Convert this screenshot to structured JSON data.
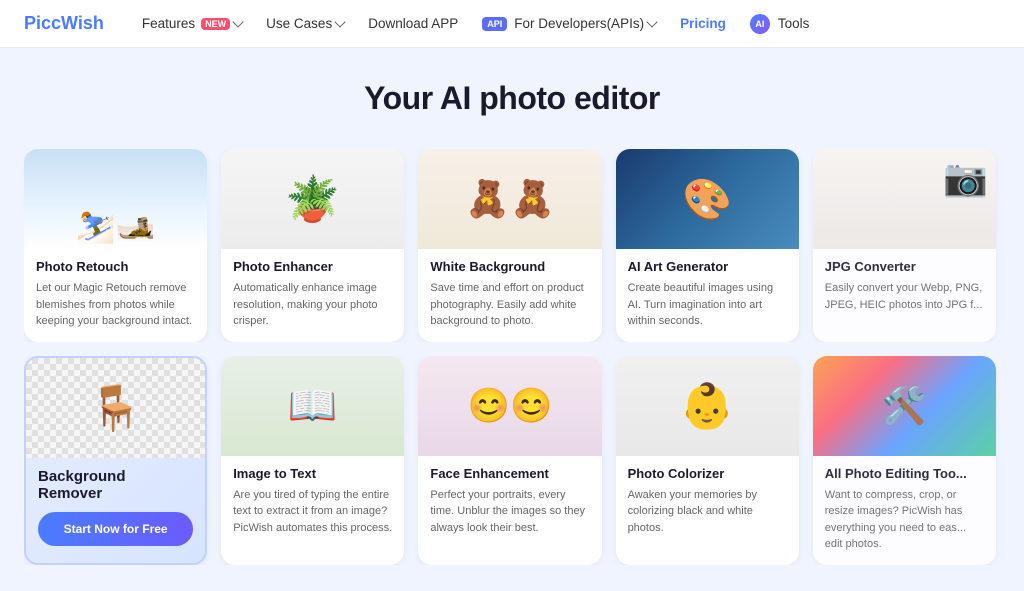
{
  "nav": {
    "logo": "cWish",
    "items": [
      {
        "label": "Features",
        "hasDropdown": true,
        "badge": "new"
      },
      {
        "label": "Use Cases",
        "hasDropdown": true
      },
      {
        "label": "Download APP",
        "hasDropdown": false
      },
      {
        "label": "For Developers(APIs)",
        "hasDropdown": true,
        "apiBadge": true
      },
      {
        "label": "Pricing",
        "isHighlighted": true
      },
      {
        "label": "Tools",
        "aiIcon": true
      }
    ]
  },
  "hero": {
    "title": "Your AI photo editor"
  },
  "row1": [
    {
      "id": "photo-retouch",
      "title": "Photo Retouch",
      "desc": "Let our Magic Retouch remove blemishes from photos while keeping your background intact.",
      "imgClass": "img-skiers"
    },
    {
      "id": "photo-enhancer",
      "title": "Photo Enhancer",
      "desc": "Automatically enhance image resolution, making your photo crisper.",
      "imgClass": "img-plant"
    },
    {
      "id": "white-background",
      "title": "White Background",
      "desc": "Save time and effort on product photography. Easily add white background to photo.",
      "imgClass": "img-bears"
    },
    {
      "id": "ai-art-generator",
      "title": "AI Art Generator",
      "desc": "Create beautiful images using AI. Turn imagination into art within seconds.",
      "imgClass": "img-anime"
    },
    {
      "id": "jpg-converter",
      "title": "JPG Converter",
      "desc": "Easily convert your Webp, PNG, JPEG, HEIC photos into JPG f...",
      "imgClass": "img-jpg"
    }
  ],
  "row2": [
    {
      "id": "background-remover",
      "title": "Background Remover",
      "desc": "",
      "imgClass": "img-chair",
      "featured": true,
      "btnLabel": "Start Now for Free"
    },
    {
      "id": "image-to-text",
      "title": "Image to Text",
      "desc": "Are you tired of typing the entire text to extract it from an image? PicWish automates this process.",
      "imgClass": "img-book"
    },
    {
      "id": "face-enhancement",
      "title": "Face Enhancement",
      "desc": "Perfect your portraits, every time. Unblur the images so they always look their best.",
      "imgClass": "img-face"
    },
    {
      "id": "photo-colorizer",
      "title": "Photo Colorizer",
      "desc": "Awaken your memories by colorizing black and white photos.",
      "imgClass": "img-baby"
    },
    {
      "id": "all-photo-editing-tools",
      "title": "All Photo Editing Too...",
      "desc": "Want to compress, crop, or resize images? PicWish has everything you need to eas... edit photos.",
      "imgClass": "img-tools"
    }
  ]
}
